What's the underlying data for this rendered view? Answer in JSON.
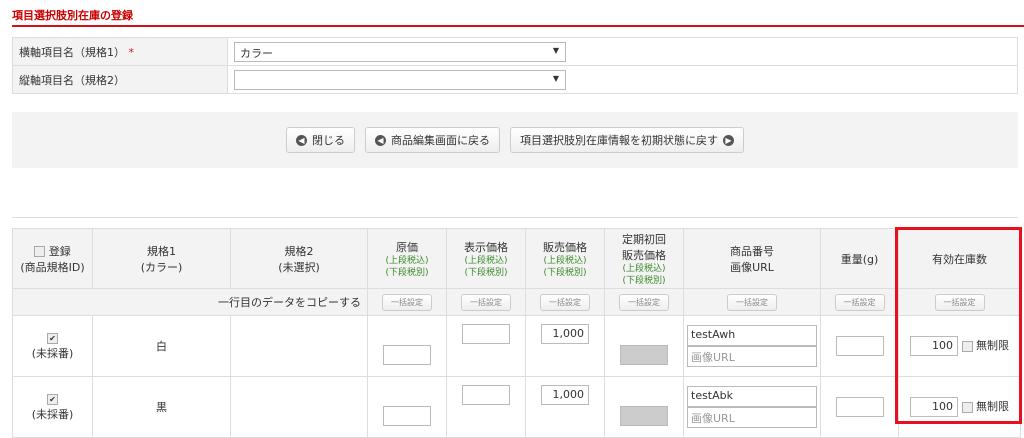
{
  "title": "項目選択肢別在庫の登録",
  "form": {
    "row1_label": "横軸項目名（規格1）",
    "required_mark": "*",
    "row1_value": "カラー",
    "row2_label": "縦軸項目名（規格2）",
    "row2_value": ""
  },
  "buttons": {
    "close": "閉じる",
    "back": "商品編集画面に戻る",
    "reset": "項目選択肢別在庫情報を初期状態に戻す"
  },
  "table": {
    "headers": {
      "register": "登録",
      "register_sub": "(商品規格ID)",
      "spec1": "規格1",
      "spec1_sub": "(カラー)",
      "spec2": "規格2",
      "spec2_sub": "(未選択)",
      "cost": "原価",
      "display_price": "表示価格",
      "sale_price": "販売価格",
      "subscription_l1": "定期初回",
      "subscription_l2": "販売価格",
      "tax_in": "(上段税込)",
      "tax_ex": "(下段税別)",
      "code_l1": "商品番号",
      "code_l2": "画像URL",
      "weight": "重量(g)",
      "stock": "有効在庫数"
    },
    "copy_label": "一行目のデータをコピーする",
    "bulk_label": "一括設定",
    "rows": [
      {
        "id": "(未採番)",
        "spec1": "白",
        "cost": "",
        "display": "",
        "sale": "1,000",
        "code": "testAwh",
        "image_placeholder": "画像URL",
        "weight": "",
        "stock": "100",
        "unlimited": "無制限"
      },
      {
        "id": "(未採番)",
        "spec1": "黒",
        "cost": "",
        "display": "",
        "sale": "1,000",
        "code": "testAbk",
        "image_placeholder": "画像URL",
        "weight": "",
        "stock": "100",
        "unlimited": "無制限"
      }
    ]
  }
}
